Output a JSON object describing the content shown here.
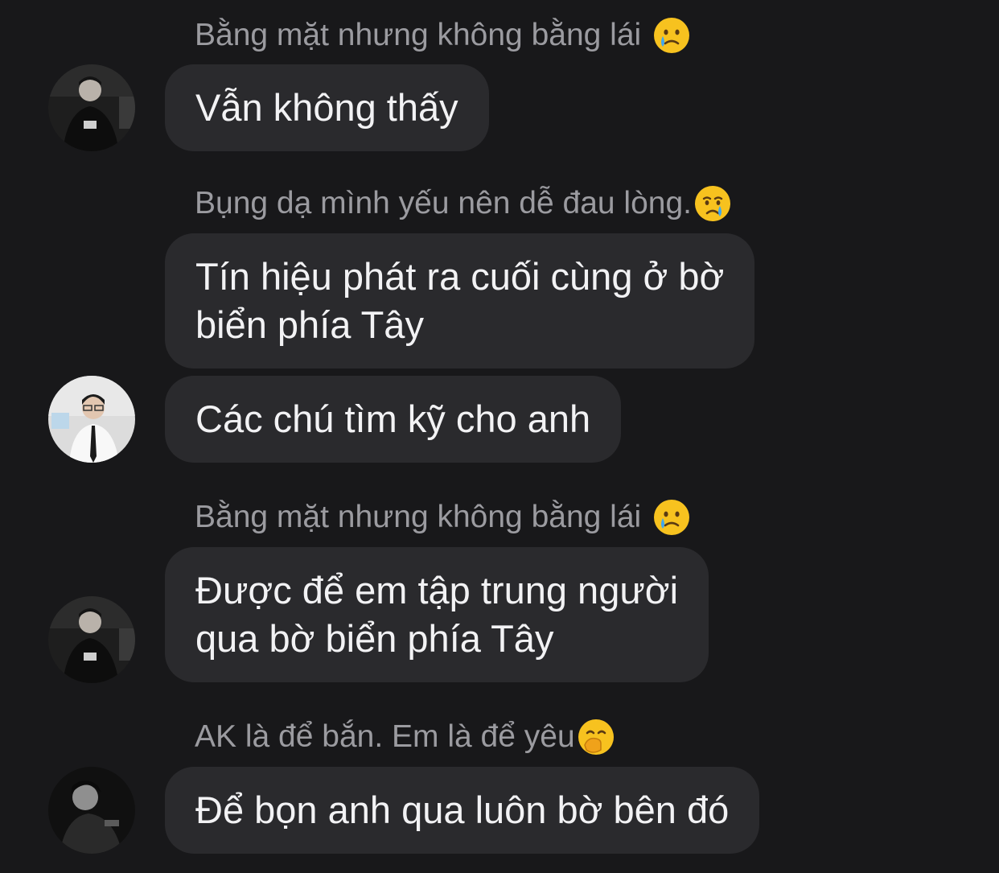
{
  "messages": [
    {
      "sender": "Bằng mặt nhưng không bằng lái",
      "sender_emoji": "crying-face-emoji",
      "bubbles": [
        {
          "lines": [
            "Vẫn không thấy"
          ]
        }
      ]
    },
    {
      "sender": "Bụng dạ mình yếu nên dễ đau lòng.",
      "sender_emoji": "crying-face-emoji",
      "bubbles": [
        {
          "lines": [
            "Tín hiệu phát ra cuối cùng ở bờ",
            "biển phía Tây"
          ]
        },
        {
          "lines": [
            "Các chú tìm kỹ cho anh"
          ]
        }
      ]
    },
    {
      "sender": "Bằng mặt nhưng không bằng lái",
      "sender_emoji": "crying-face-emoji",
      "bubbles": [
        {
          "lines": [
            "Được để em tập trung người",
            "qua bờ biển phía Tây"
          ]
        }
      ]
    },
    {
      "sender": "AK là để bắn. Em là để yêu",
      "sender_emoji": "face-with-hand-over-mouth-emoji",
      "bubbles": [
        {
          "lines": [
            "Để bọn anh qua luôn bờ bên đó"
          ]
        }
      ]
    }
  ],
  "colors": {
    "background": "#18181a",
    "bubble": "#2a2a2d",
    "sender_name": "#9b9ba0",
    "message_text": "#f2f2f4"
  }
}
